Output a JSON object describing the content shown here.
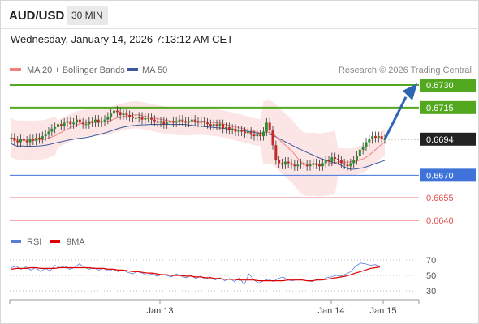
{
  "header": {
    "symbol": "AUD/USD",
    "timeframe": "30 MIN",
    "datetime": "Wednesday, January 14, 2026 7:13:12 AM CET"
  },
  "legend": {
    "ma20_label": "MA 20 + Bollinger Bands",
    "ma50_label": "MA 50",
    "source": "Research © 2026 Trading Central",
    "ma20_color": "#f08080",
    "ma50_color": "#3b5a9a"
  },
  "rsi_legend": {
    "rsi_label": "RSI",
    "ma9_label": "9MA",
    "rsi_color": "#5b7fd9",
    "ma9_color": "#e00000"
  },
  "colors": {
    "resistance": "#52a81e",
    "pivot": "#3f73d9",
    "support": "#e05050",
    "current": "#222222",
    "bull_candle": "#2e8b2e",
    "bear_candle": "#c62828",
    "arrow": "#2e64b4"
  },
  "chart_data": [
    {
      "type": "candlestick",
      "x_ticks": [
        "Jan 13",
        "Jan 14",
        "Jan 15"
      ],
      "levels": [
        {
          "value": 0.673,
          "label": "0.6730",
          "kind": "resistance"
        },
        {
          "value": 0.6715,
          "label": "0.6715",
          "kind": "resistance"
        },
        {
          "value": 0.6694,
          "label": "0.6694",
          "kind": "current"
        },
        {
          "value": 0.667,
          "label": "0.6670",
          "kind": "pivot"
        },
        {
          "value": 0.6655,
          "label": "0.6655",
          "kind": "support"
        },
        {
          "value": 0.664,
          "label": "0.6640",
          "kind": "support"
        }
      ],
      "closes": [
        0.6695,
        0.6693,
        0.6692,
        0.6694,
        0.6693,
        0.6692,
        0.6694,
        0.6693,
        0.6695,
        0.6694,
        0.6696,
        0.6697,
        0.6699,
        0.6701,
        0.6702,
        0.6704,
        0.6703,
        0.6705,
        0.6706,
        0.6704,
        0.6705,
        0.6707,
        0.6705,
        0.6704,
        0.6704,
        0.6706,
        0.6705,
        0.6707,
        0.6705,
        0.6706,
        0.6707,
        0.6709,
        0.6711,
        0.6713,
        0.6712,
        0.671,
        0.6711,
        0.671,
        0.6709,
        0.6708,
        0.6708,
        0.6709,
        0.6707,
        0.6708,
        0.6708,
        0.6707,
        0.6706,
        0.6705,
        0.6706,
        0.6704,
        0.6705,
        0.6706,
        0.6705,
        0.6706,
        0.6707,
        0.6706,
        0.6705,
        0.6706,
        0.6707,
        0.6706,
        0.6705,
        0.6706,
        0.6705,
        0.6704,
        0.6703,
        0.6704,
        0.6703,
        0.6704,
        0.6701,
        0.6702,
        0.67,
        0.6701,
        0.6699,
        0.67,
        0.6699,
        0.6698,
        0.6699,
        0.6697,
        0.6696,
        0.6697,
        0.6696,
        0.6699,
        0.6705,
        0.67,
        0.669,
        0.668,
        0.6678,
        0.6677,
        0.6679,
        0.6678,
        0.6677,
        0.6676,
        0.6677,
        0.6678,
        0.6677,
        0.6676,
        0.6677,
        0.6678,
        0.6677,
        0.6676,
        0.6678,
        0.668,
        0.6679,
        0.6682,
        0.6681,
        0.668,
        0.6678,
        0.6677,
        0.6676,
        0.6678,
        0.668,
        0.6683,
        0.6687,
        0.6689,
        0.6692,
        0.6694,
        0.6696,
        0.6695,
        0.6696,
        0.6694,
        0.6694
      ]
    },
    {
      "type": "line",
      "title": "RSI",
      "y_ticks": [
        70,
        50,
        30
      ],
      "ylim": [
        20,
        80
      ],
      "series": [
        {
          "name": "RSI",
          "values": [
            60,
            62,
            58,
            61,
            57,
            60,
            55,
            59,
            56,
            63,
            60,
            62,
            58,
            60,
            65,
            61,
            58,
            60,
            57,
            59,
            56,
            58,
            55,
            57,
            54,
            52,
            55,
            53,
            50,
            52,
            49,
            51,
            50,
            48,
            52,
            49,
            47,
            50,
            46,
            49,
            45,
            48,
            44,
            47,
            43,
            46,
            42,
            47,
            38,
            52,
            44,
            40,
            43,
            45,
            42,
            46,
            48,
            44,
            43,
            45,
            44,
            43,
            42,
            45,
            44,
            47,
            48,
            50,
            49,
            52,
            55,
            62,
            66,
            65,
            63,
            64,
            62
          ]
        },
        {
          "name": "9MA",
          "values": [
            58,
            59,
            59,
            59,
            60,
            60,
            59,
            59,
            59,
            59,
            60,
            60,
            60,
            60,
            60,
            60,
            60,
            59,
            59,
            59,
            58,
            58,
            57,
            57,
            56,
            55,
            55,
            54,
            53,
            53,
            52,
            51,
            51,
            50,
            50,
            50,
            49,
            49,
            48,
            48,
            47,
            47,
            46,
            46,
            45,
            45,
            45,
            44,
            44,
            44,
            44,
            43,
            43,
            43,
            43,
            43,
            43,
            44,
            44,
            44,
            44,
            43,
            43,
            44,
            44,
            45,
            46,
            47,
            48,
            49,
            51,
            53,
            55,
            57,
            59,
            60,
            61
          ]
        }
      ]
    }
  ]
}
